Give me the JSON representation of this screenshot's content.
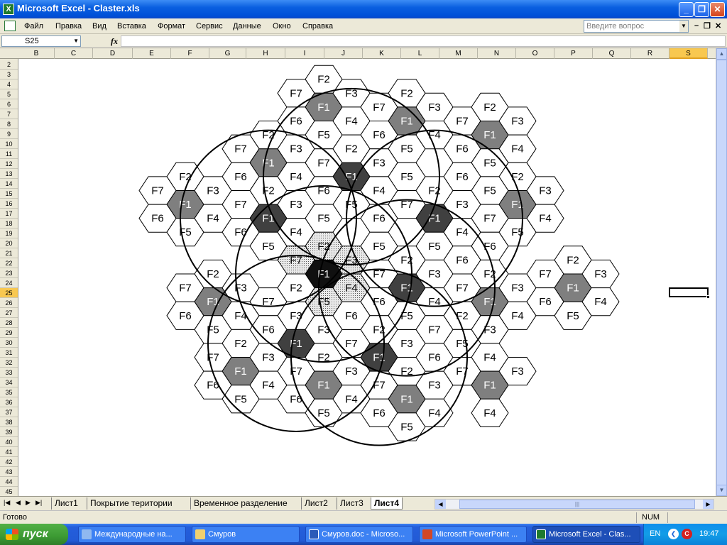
{
  "window": {
    "title": "Microsoft Excel - Claster.xls",
    "app_icon": "X"
  },
  "menu": {
    "items": [
      "Файл",
      "Правка",
      "Вид",
      "Вставка",
      "Формат",
      "Сервис",
      "Данные",
      "Окно",
      "Справка"
    ],
    "ask_placeholder": "Введите вопрос"
  },
  "formula": {
    "name_box": "S25",
    "fx": "fx",
    "value": ""
  },
  "columns": [
    "B",
    "C",
    "D",
    "E",
    "F",
    "G",
    "H",
    "I",
    "J",
    "K",
    "L",
    "M",
    "N",
    "O",
    "P",
    "Q",
    "R",
    "S"
  ],
  "selected_column": "S",
  "rows": [
    "2",
    "3",
    "4",
    "5",
    "6",
    "7",
    "8",
    "9",
    "10",
    "11",
    "12",
    "13",
    "14",
    "15",
    "16",
    "17",
    "18",
    "19",
    "20",
    "21",
    "22",
    "23",
    "24",
    "25",
    "26",
    "27",
    "28",
    "29",
    "30",
    "31",
    "32",
    "33",
    "34",
    "35",
    "36",
    "37",
    "38",
    "39",
    "40",
    "41",
    "42",
    "43",
    "44",
    "45"
  ],
  "selected_row": "25",
  "sheet_tabs": [
    "Лист1",
    "Покрытие територии",
    "Временное разделение",
    "Лист2",
    "Лист3",
    "Лист4"
  ],
  "active_tab": "Лист4",
  "status": {
    "text": "Готово",
    "num": "NUM"
  },
  "taskbar": {
    "start": "пуск",
    "tasks": [
      "Международные на...",
      "Смуров",
      "Смуров.doc - Microso...",
      "Microsoft PowerPoint ...",
      "Microsoft Excel - Clas..."
    ],
    "active_task": "Microsoft Excel - Clas...",
    "lang": "EN",
    "clock": "19:47"
  },
  "drawing": {
    "cells": [
      {
        "q": 0,
        "r": -7,
        "l": "F2",
        "f": "w"
      },
      {
        "q": -1,
        "r": -6,
        "l": "F7",
        "f": "w"
      },
      {
        "q": 0,
        "r": -6,
        "l": "F1",
        "f": "g"
      },
      {
        "q": 1,
        "r": -7,
        "l": "F3",
        "f": "w"
      },
      {
        "q": -1,
        "r": -5,
        "l": "F6",
        "f": "w"
      },
      {
        "q": 0,
        "r": -5,
        "l": "F5",
        "f": "w"
      },
      {
        "q": 1,
        "r": -6,
        "l": "F4",
        "f": "w"
      },
      {
        "q": 2,
        "r": -7,
        "l": "F7",
        "f": "w"
      },
      {
        "q": 3,
        "r": -8,
        "l": "F2",
        "f": "w"
      },
      {
        "q": 3,
        "r": -7,
        "l": "F1",
        "f": "g"
      },
      {
        "q": 4,
        "r": -8,
        "l": "F3",
        "f": "w"
      },
      {
        "q": 2,
        "r": -6,
        "l": "F6",
        "f": "w"
      },
      {
        "q": 3,
        "r": -6,
        "l": "F5",
        "f": "w"
      },
      {
        "q": 4,
        "r": -7,
        "l": "F4",
        "f": "w"
      },
      {
        "q": 5,
        "r": -8,
        "l": "F7",
        "f": "w"
      },
      {
        "q": 6,
        "r": -9,
        "l": "F2",
        "f": "w"
      },
      {
        "q": 6,
        "r": -8,
        "l": "F1",
        "f": "g"
      },
      {
        "q": 7,
        "r": -9,
        "l": "F3",
        "f": "w"
      },
      {
        "q": 5,
        "r": -7,
        "l": "F6",
        "f": "w"
      },
      {
        "q": 6,
        "r": -7,
        "l": "F5",
        "f": "w"
      },
      {
        "q": 7,
        "r": -8,
        "l": "F4",
        "f": "w"
      },
      {
        "q": -2,
        "r": -4,
        "l": "F2",
        "f": "w"
      },
      {
        "q": -3,
        "r": -3,
        "l": "F7",
        "f": "w"
      },
      {
        "q": -2,
        "r": -3,
        "l": "F1",
        "f": "g"
      },
      {
        "q": -1,
        "r": -4,
        "l": "F3",
        "f": "w"
      },
      {
        "q": -3,
        "r": -2,
        "l": "F6",
        "f": "w"
      },
      {
        "q": -2,
        "r": -2,
        "l": "F5",
        "f": "w"
      },
      {
        "q": -1,
        "r": -3,
        "l": "F4",
        "f": "w"
      },
      {
        "q": 0,
        "r": -4,
        "l": "F7",
        "f": "w"
      },
      {
        "q": 1,
        "r": -5,
        "l": "F2",
        "f": "w"
      },
      {
        "q": 1,
        "r": -4,
        "l": "F1",
        "f": "d"
      },
      {
        "q": 2,
        "r": -5,
        "l": "F3",
        "f": "w"
      },
      {
        "q": 0,
        "r": -3,
        "l": "F6",
        "f": "w"
      },
      {
        "q": 1,
        "r": -3,
        "l": "F5",
        "f": "w"
      },
      {
        "q": 2,
        "r": -4,
        "l": "F4",
        "f": "w"
      },
      {
        "q": 3,
        "r": -5,
        "l": "F5",
        "f": "w"
      },
      {
        "q": 3,
        "r": -4,
        "l": "F7",
        "f": "w"
      },
      {
        "q": 4,
        "r": -5,
        "l": "F2",
        "f": "w"
      },
      {
        "q": 4,
        "r": -4,
        "l": "F1",
        "f": "d"
      },
      {
        "q": 5,
        "r": -5,
        "l": "F3",
        "f": "w"
      },
      {
        "q": 4,
        "r": -3,
        "l": "F5",
        "f": "w"
      },
      {
        "q": 5,
        "r": -4,
        "l": "F4",
        "f": "w"
      },
      {
        "q": 5,
        "r": -6,
        "l": "F6",
        "f": "w"
      },
      {
        "q": 6,
        "r": -6,
        "l": "F5",
        "f": "w"
      },
      {
        "q": 7,
        "r": -7,
        "l": "F2",
        "f": "w"
      },
      {
        "q": 6,
        "r": -5,
        "l": "F7",
        "f": "w"
      },
      {
        "q": 7,
        "r": -6,
        "l": "F1",
        "f": "g"
      },
      {
        "q": 8,
        "r": -7,
        "l": "F3",
        "f": "w"
      },
      {
        "q": 6,
        "r": -4,
        "l": "F6",
        "f": "w"
      },
      {
        "q": 7,
        "r": -5,
        "l": "F5",
        "f": "w"
      },
      {
        "q": 8,
        "r": -6,
        "l": "F4",
        "f": "w"
      },
      {
        "q": -5,
        "r": -1,
        "l": "F2",
        "f": "w"
      },
      {
        "q": -6,
        "r": 0,
        "l": "F7",
        "f": "w"
      },
      {
        "q": -5,
        "r": 0,
        "l": "F1",
        "f": "g"
      },
      {
        "q": -4,
        "r": -1,
        "l": "F3",
        "f": "w"
      },
      {
        "q": -6,
        "r": 1,
        "l": "F6",
        "f": "w"
      },
      {
        "q": -5,
        "r": 1,
        "l": "F5",
        "f": "w"
      },
      {
        "q": -4,
        "r": 0,
        "l": "F4",
        "f": "w"
      },
      {
        "q": -3,
        "r": -1,
        "l": "F7",
        "f": "w"
      },
      {
        "q": -2,
        "r": -2,
        "l": "F2",
        "f": "w"
      },
      {
        "q": -2,
        "r": -1,
        "l": "F1",
        "f": "d"
      },
      {
        "q": -1,
        "r": -2,
        "l": "F3",
        "f": "w"
      },
      {
        "q": -3,
        "r": 0,
        "l": "F6",
        "f": "w"
      },
      {
        "q": -2,
        "r": 0,
        "l": "F5",
        "f": "w"
      },
      {
        "q": -1,
        "r": -1,
        "l": "F4",
        "f": "w"
      },
      {
        "q": 0,
        "r": -2,
        "l": "F5",
        "f": "w"
      },
      {
        "q": 0,
        "r": 0,
        "l": "F1",
        "f": "c"
      },
      {
        "q": 0,
        "r": -1,
        "l": "F2",
        "f": "h"
      },
      {
        "q": 1,
        "r": -1,
        "l": "F3",
        "f": "h"
      },
      {
        "q": 1,
        "r": 0,
        "l": "F4",
        "f": "h"
      },
      {
        "q": 0,
        "r": 1,
        "l": "F5",
        "f": "h"
      },
      {
        "q": -1,
        "r": 1,
        "l": "F6",
        "f": "h"
      },
      {
        "q": -1,
        "r": 0,
        "l": "F7",
        "f": "h"
      },
      {
        "q": 2,
        "r": -1,
        "l": "F7",
        "f": "w"
      },
      {
        "q": 3,
        "r": -2,
        "l": "F2",
        "f": "w"
      },
      {
        "q": 3,
        "r": -1,
        "l": "F1",
        "f": "d"
      },
      {
        "q": 4,
        "r": -2,
        "l": "F3",
        "f": "w"
      },
      {
        "q": 2,
        "r": 0,
        "l": "F6",
        "f": "w"
      },
      {
        "q": 3,
        "r": 0,
        "l": "F5",
        "f": "w"
      },
      {
        "q": 4,
        "r": -1,
        "l": "F4",
        "f": "w"
      },
      {
        "q": 5,
        "r": -3,
        "l": "F6",
        "f": "w"
      },
      {
        "q": 2,
        "r": -3,
        "l": "F6",
        "f": "w"
      },
      {
        "q": 2,
        "r": -2,
        "l": "F5",
        "f": "w"
      },
      {
        "q": 5,
        "r": -2,
        "l": "F7",
        "f": "w"
      },
      {
        "q": 6,
        "r": -3,
        "l": "F2",
        "f": "w"
      },
      {
        "q": 6,
        "r": -2,
        "l": "F1",
        "f": "g"
      },
      {
        "q": 7,
        "r": -3,
        "l": "F3",
        "f": "w"
      },
      {
        "q": 5,
        "r": -1,
        "l": "F6",
        "f": "w"
      },
      {
        "q": 6,
        "r": -1,
        "l": "F5",
        "f": "w"
      },
      {
        "q": 7,
        "r": -2,
        "l": "F4",
        "f": "w"
      },
      {
        "q": -4,
        "r": 2,
        "l": "F2",
        "f": "w"
      },
      {
        "q": -5,
        "r": 3,
        "l": "F7",
        "f": "w"
      },
      {
        "q": -4,
        "r": 3,
        "l": "F1",
        "f": "g"
      },
      {
        "q": -3,
        "r": 2,
        "l": "F3",
        "f": "w"
      },
      {
        "q": -5,
        "r": 4,
        "l": "F6",
        "f": "w"
      },
      {
        "q": -4,
        "r": 4,
        "l": "F5",
        "f": "w"
      },
      {
        "q": -3,
        "r": 3,
        "l": "F4",
        "f": "w"
      },
      {
        "q": -2,
        "r": 2,
        "l": "F7",
        "f": "w"
      },
      {
        "q": -1,
        "r": 2,
        "l": "F3",
        "f": "w"
      },
      {
        "q": -1,
        "r": 3,
        "l": "F1",
        "f": "d"
      },
      {
        "q": 0,
        "r": 2,
        "l": "F3",
        "f": "w"
      },
      {
        "q": -2,
        "r": 3,
        "l": "F6",
        "f": "w"
      },
      {
        "q": -1,
        "r": 4,
        "l": "F5",
        "f": "w"
      },
      {
        "q": 0,
        "r": 3,
        "l": "F4",
        "f": "w"
      },
      {
        "q": -1,
        "r": 1,
        "l": "F2",
        "f": "w"
      },
      {
        "q": 1,
        "r": 2,
        "l": "F7",
        "f": "w"
      },
      {
        "q": 2,
        "r": 1,
        "l": "F2",
        "f": "w"
      },
      {
        "q": 2,
        "r": 2,
        "l": "F1",
        "f": "d"
      },
      {
        "q": 3,
        "r": 1,
        "l": "F3",
        "f": "w"
      },
      {
        "q": 1,
        "r": 3,
        "l": "F6",
        "f": "w"
      },
      {
        "q": 2,
        "r": 3,
        "l": "F5",
        "f": "w"
      },
      {
        "q": 3,
        "r": 2,
        "l": "F4",
        "f": "w"
      },
      {
        "q": 1,
        "r": 1,
        "l": "F6",
        "f": "w"
      },
      {
        "q": 3,
        "r": 0,
        "l": "F5",
        "f": "w"
      },
      {
        "q": 4,
        "r": 0,
        "l": "F7",
        "f": "w"
      },
      {
        "q": 5,
        "r": -1,
        "l": "F2",
        "f": "w"
      },
      {
        "q": 5,
        "r": 0,
        "l": "F1",
        "f": "g"
      },
      {
        "q": 6,
        "r": -1,
        "l": "F3",
        "f": "w"
      },
      {
        "q": 4,
        "r": 1,
        "l": "F6",
        "f": "w"
      },
      {
        "q": 5,
        "r": 1,
        "l": "F5",
        "f": "w"
      },
      {
        "q": 6,
        "r": 0,
        "l": "F4",
        "f": "w"
      },
      {
        "q": 8,
        "r": -4,
        "l": "F7",
        "f": "w"
      },
      {
        "q": 9,
        "r": -5,
        "l": "F2",
        "f": "w"
      },
      {
        "q": 9,
        "r": -4,
        "l": "F1",
        "f": "g"
      },
      {
        "q": 10,
        "r": -5,
        "l": "F3",
        "f": "w"
      },
      {
        "q": 8,
        "r": -3,
        "l": "F6",
        "f": "w"
      },
      {
        "q": 9,
        "r": -3,
        "l": "F5",
        "f": "w"
      },
      {
        "q": 10,
        "r": -4,
        "l": "F4",
        "f": "w"
      },
      {
        "q": -3,
        "r": 4,
        "l": "F2",
        "f": "w"
      },
      {
        "q": -4,
        "r": 5,
        "l": "F7",
        "f": "w"
      },
      {
        "q": -3,
        "r": 5,
        "l": "F1",
        "f": "g"
      },
      {
        "q": -2,
        "r": 4,
        "l": "F3",
        "f": "w"
      },
      {
        "q": -4,
        "r": 6,
        "l": "F6",
        "f": "w"
      },
      {
        "q": -3,
        "r": 6,
        "l": "F5",
        "f": "w"
      },
      {
        "q": -2,
        "r": 5,
        "l": "F4",
        "f": "w"
      },
      {
        "q": -1,
        "r": 4,
        "l": "F7",
        "f": "w"
      },
      {
        "q": 0,
        "r": 3,
        "l": "F2",
        "f": "w"
      },
      {
        "q": 0,
        "r": 4,
        "l": "F1",
        "f": "g"
      },
      {
        "q": 1,
        "r": 3,
        "l": "F3",
        "f": "w"
      },
      {
        "q": -1,
        "r": 5,
        "l": "F6",
        "f": "w"
      },
      {
        "q": 0,
        "r": 5,
        "l": "F5",
        "f": "w"
      },
      {
        "q": 1,
        "r": 4,
        "l": "F4",
        "f": "w"
      },
      {
        "q": 2,
        "r": 3,
        "l": "F7",
        "f": "w"
      },
      {
        "q": 3,
        "r": 2,
        "l": "F2",
        "f": "w"
      },
      {
        "q": 3,
        "r": 3,
        "l": "F1",
        "f": "g"
      },
      {
        "q": 4,
        "r": 2,
        "l": "F3",
        "f": "w"
      },
      {
        "q": 2,
        "r": 4,
        "l": "F6",
        "f": "w"
      },
      {
        "q": 3,
        "r": 4,
        "l": "F5",
        "f": "w"
      },
      {
        "q": 4,
        "r": 3,
        "l": "F4",
        "f": "w"
      },
      {
        "q": 4,
        "r": 1,
        "l": "F6",
        "f": "w"
      },
      {
        "q": 5,
        "r": 0,
        "l": "F5",
        "f": "w"
      },
      {
        "q": 5,
        "r": 1,
        "l": "F7",
        "f": "w"
      },
      {
        "q": 6,
        "r": 1,
        "l": "F1",
        "f": "g"
      },
      {
        "q": 7,
        "r": 0,
        "l": "F3",
        "f": "w"
      },
      {
        "q": 6,
        "r": 2,
        "l": "F4",
        "f": "w"
      }
    ],
    "circles": [
      {
        "q": 0,
        "r": 0
      },
      {
        "q": 1,
        "r": -4
      },
      {
        "q": 4,
        "r": -4
      },
      {
        "q": -2,
        "r": -1
      },
      {
        "q": 3,
        "r": -1
      },
      {
        "q": -1,
        "r": 3
      },
      {
        "q": 2,
        "r": 2
      }
    ]
  }
}
